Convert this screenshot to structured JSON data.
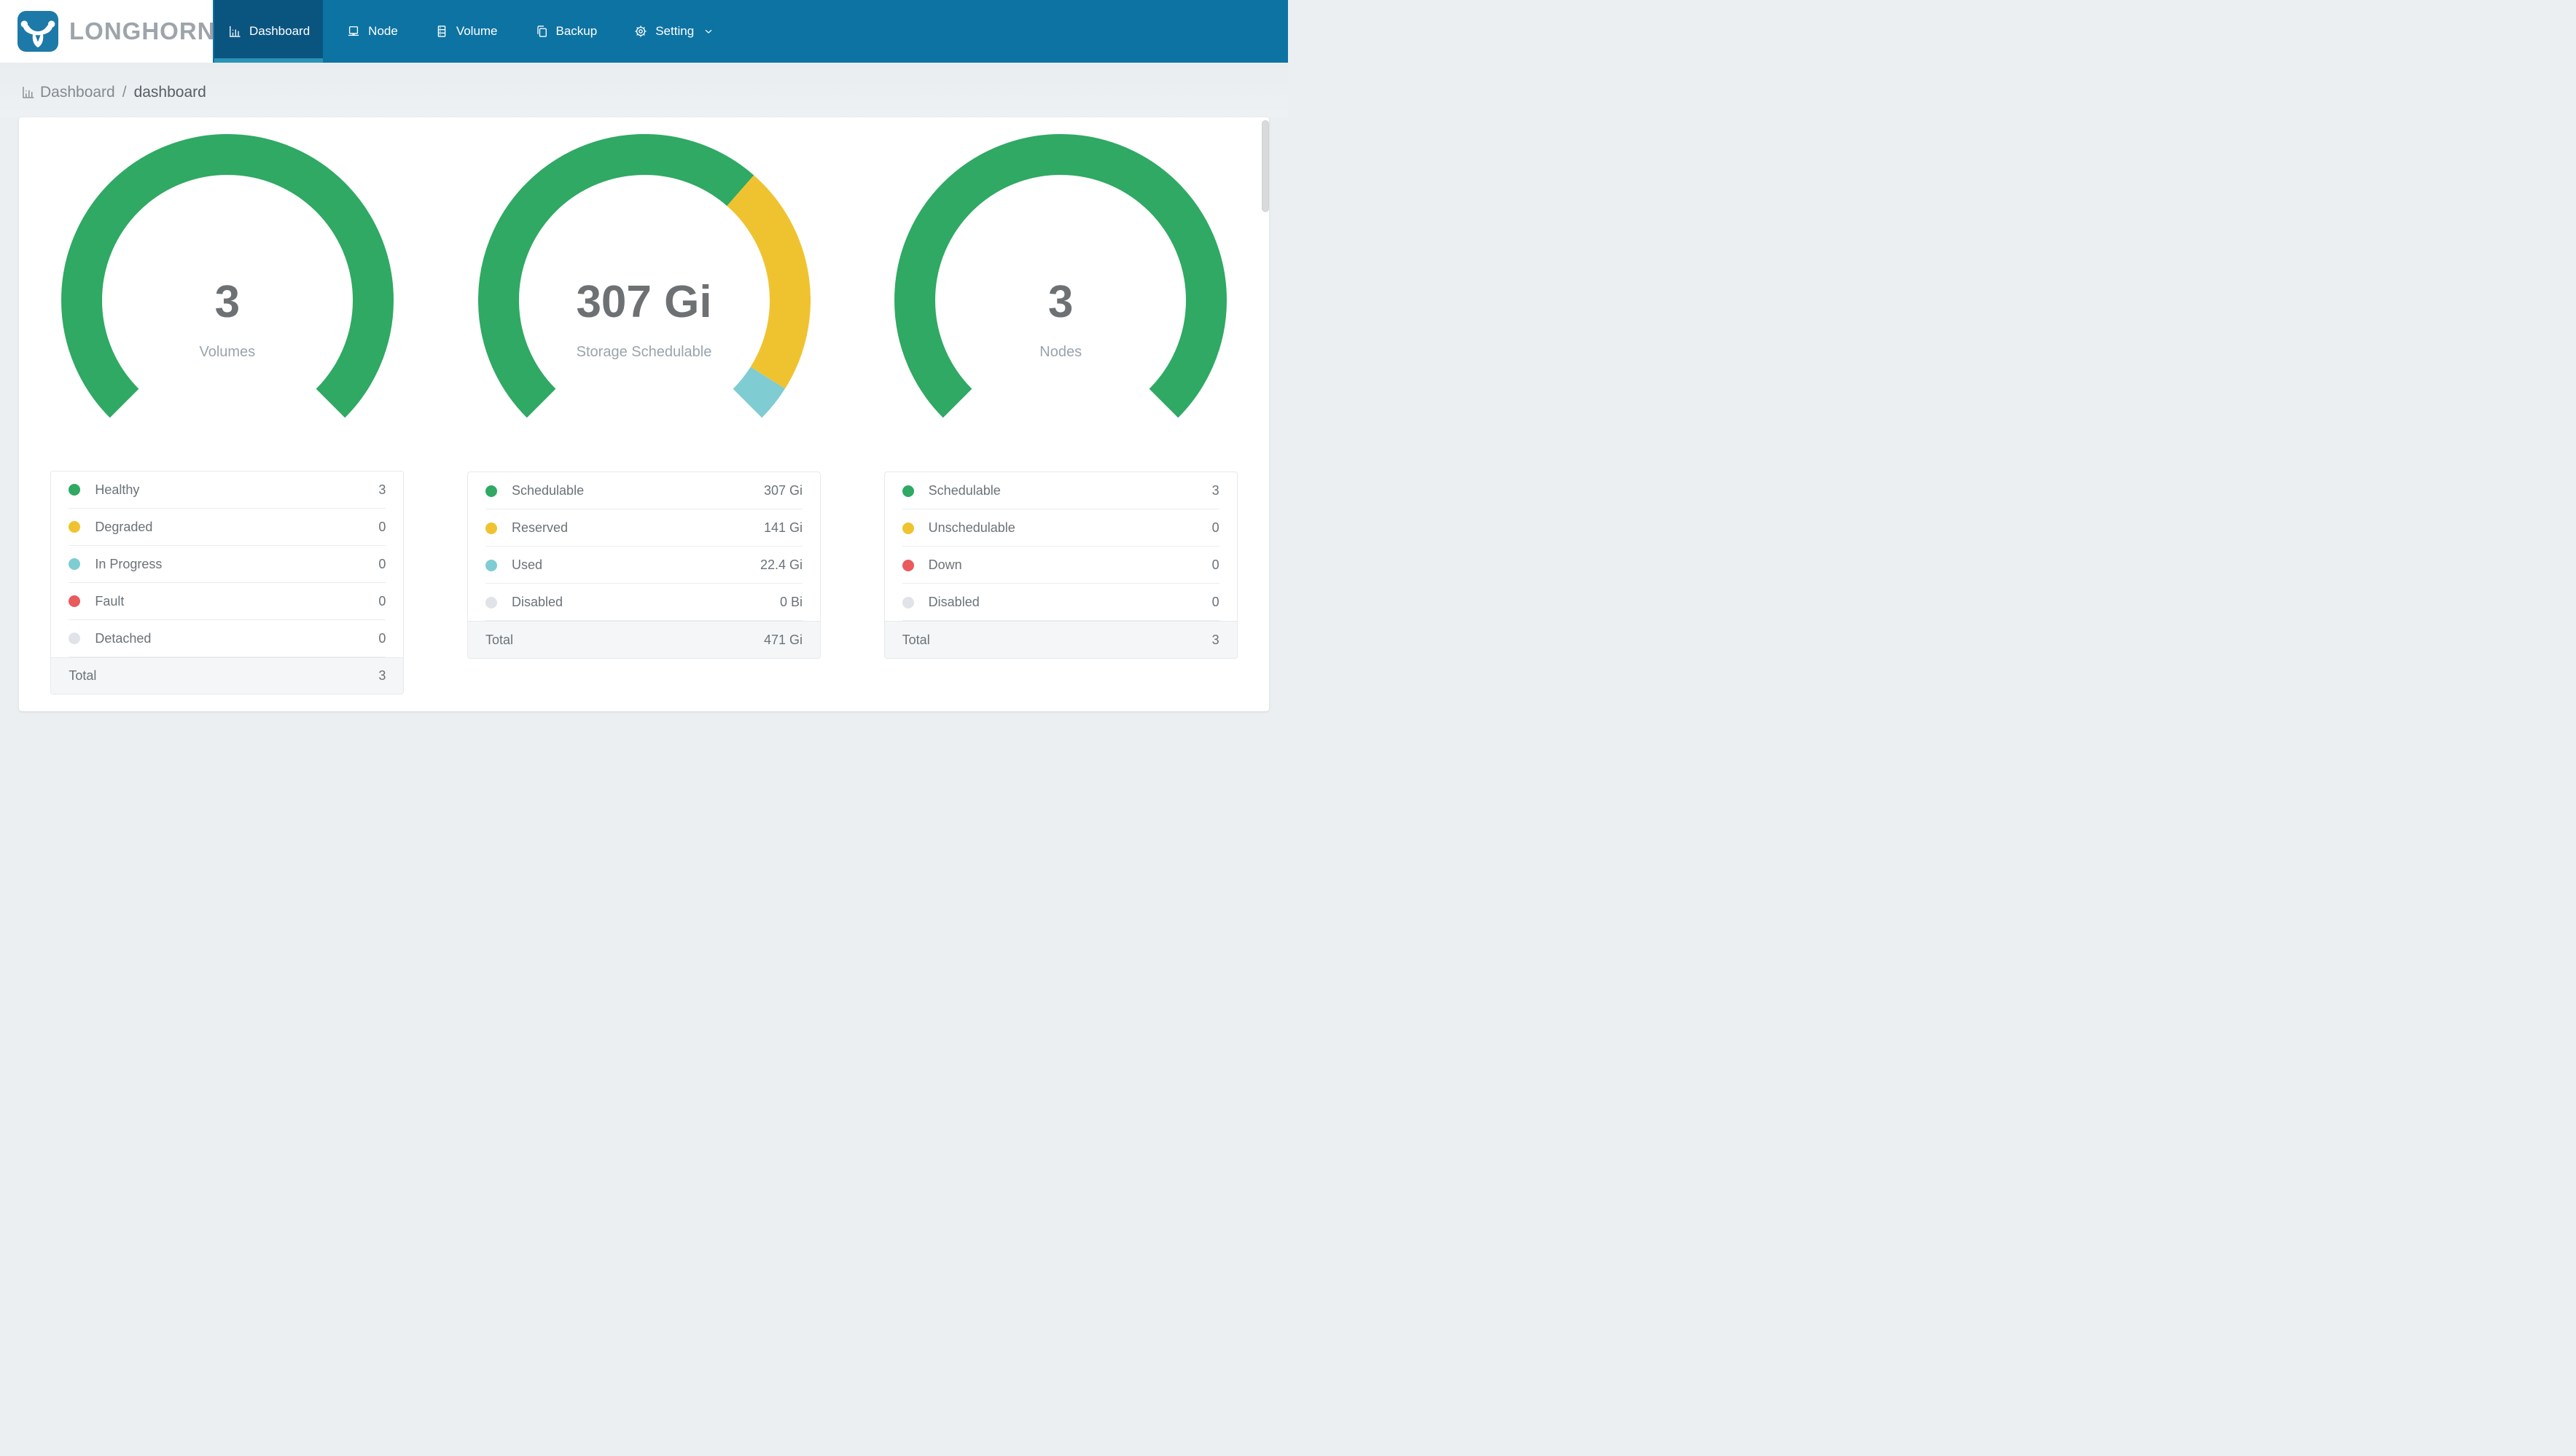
{
  "header": {
    "brand": "LONGHORN",
    "nav": [
      {
        "label": "Dashboard",
        "icon": "dashboard-icon",
        "active": true
      },
      {
        "label": "Node",
        "icon": "node-icon",
        "active": false
      },
      {
        "label": "Volume",
        "icon": "volume-icon",
        "active": false
      },
      {
        "label": "Backup",
        "icon": "backup-icon",
        "active": false
      },
      {
        "label": "Setting",
        "icon": "gear-icon",
        "active": false,
        "dropdown": true
      }
    ]
  },
  "breadcrumb": {
    "section": "Dashboard",
    "divider": "/",
    "current": "dashboard"
  },
  "palette": {
    "navbar": "#0d73a3",
    "tab_active": "#0a5480",
    "tab_active_strip": "#2b93b5",
    "logo_blue": "#1d7aa8",
    "green": "#2fa963",
    "yellow": "#efc330",
    "teal": "#7fccd2",
    "red": "#e95a5c",
    "gray": "#e0e4e8"
  },
  "chart_data": [
    {
      "type": "pie",
      "variant": "gauge-donut",
      "key": "volumes",
      "start_angle": 225,
      "span_angle": 270,
      "legend_position": "bottom",
      "center_value": "3",
      "center_label": "Volumes",
      "segments": [
        {
          "label": "Healthy",
          "value": 3,
          "display": "3",
          "color": "green"
        },
        {
          "label": "Degraded",
          "value": 0,
          "display": "0",
          "color": "yellow"
        },
        {
          "label": "In Progress",
          "value": 0,
          "display": "0",
          "color": "teal"
        },
        {
          "label": "Fault",
          "value": 0,
          "display": "0",
          "color": "red"
        },
        {
          "label": "Detached",
          "value": 0,
          "display": "0",
          "color": "gray"
        }
      ],
      "total": {
        "label": "Total",
        "display": "3"
      }
    },
    {
      "type": "pie",
      "variant": "gauge-donut",
      "key": "storage",
      "start_angle": 225,
      "span_angle": 270,
      "legend_position": "bottom",
      "center_value": "307 Gi",
      "center_label": "Storage Schedulable",
      "segments": [
        {
          "label": "Schedulable",
          "value": 307,
          "display": "307 Gi",
          "color": "green"
        },
        {
          "label": "Reserved",
          "value": 141,
          "display": "141 Gi",
          "color": "yellow"
        },
        {
          "label": "Used",
          "value": 22.4,
          "display": "22.4 Gi",
          "color": "teal"
        },
        {
          "label": "Disabled",
          "value": 0,
          "display": "0 Bi",
          "color": "gray"
        }
      ],
      "total": {
        "label": "Total",
        "display": "471 Gi"
      }
    },
    {
      "type": "pie",
      "variant": "gauge-donut",
      "key": "nodes",
      "start_angle": 225,
      "span_angle": 270,
      "legend_position": "bottom",
      "center_value": "3",
      "center_label": "Nodes",
      "segments": [
        {
          "label": "Schedulable",
          "value": 3,
          "display": "3",
          "color": "green"
        },
        {
          "label": "Unschedulable",
          "value": 0,
          "display": "0",
          "color": "yellow"
        },
        {
          "label": "Down",
          "value": 0,
          "display": "0",
          "color": "red"
        },
        {
          "label": "Disabled",
          "value": 0,
          "display": "0",
          "color": "gray"
        }
      ],
      "total": {
        "label": "Total",
        "display": "3"
      }
    }
  ]
}
